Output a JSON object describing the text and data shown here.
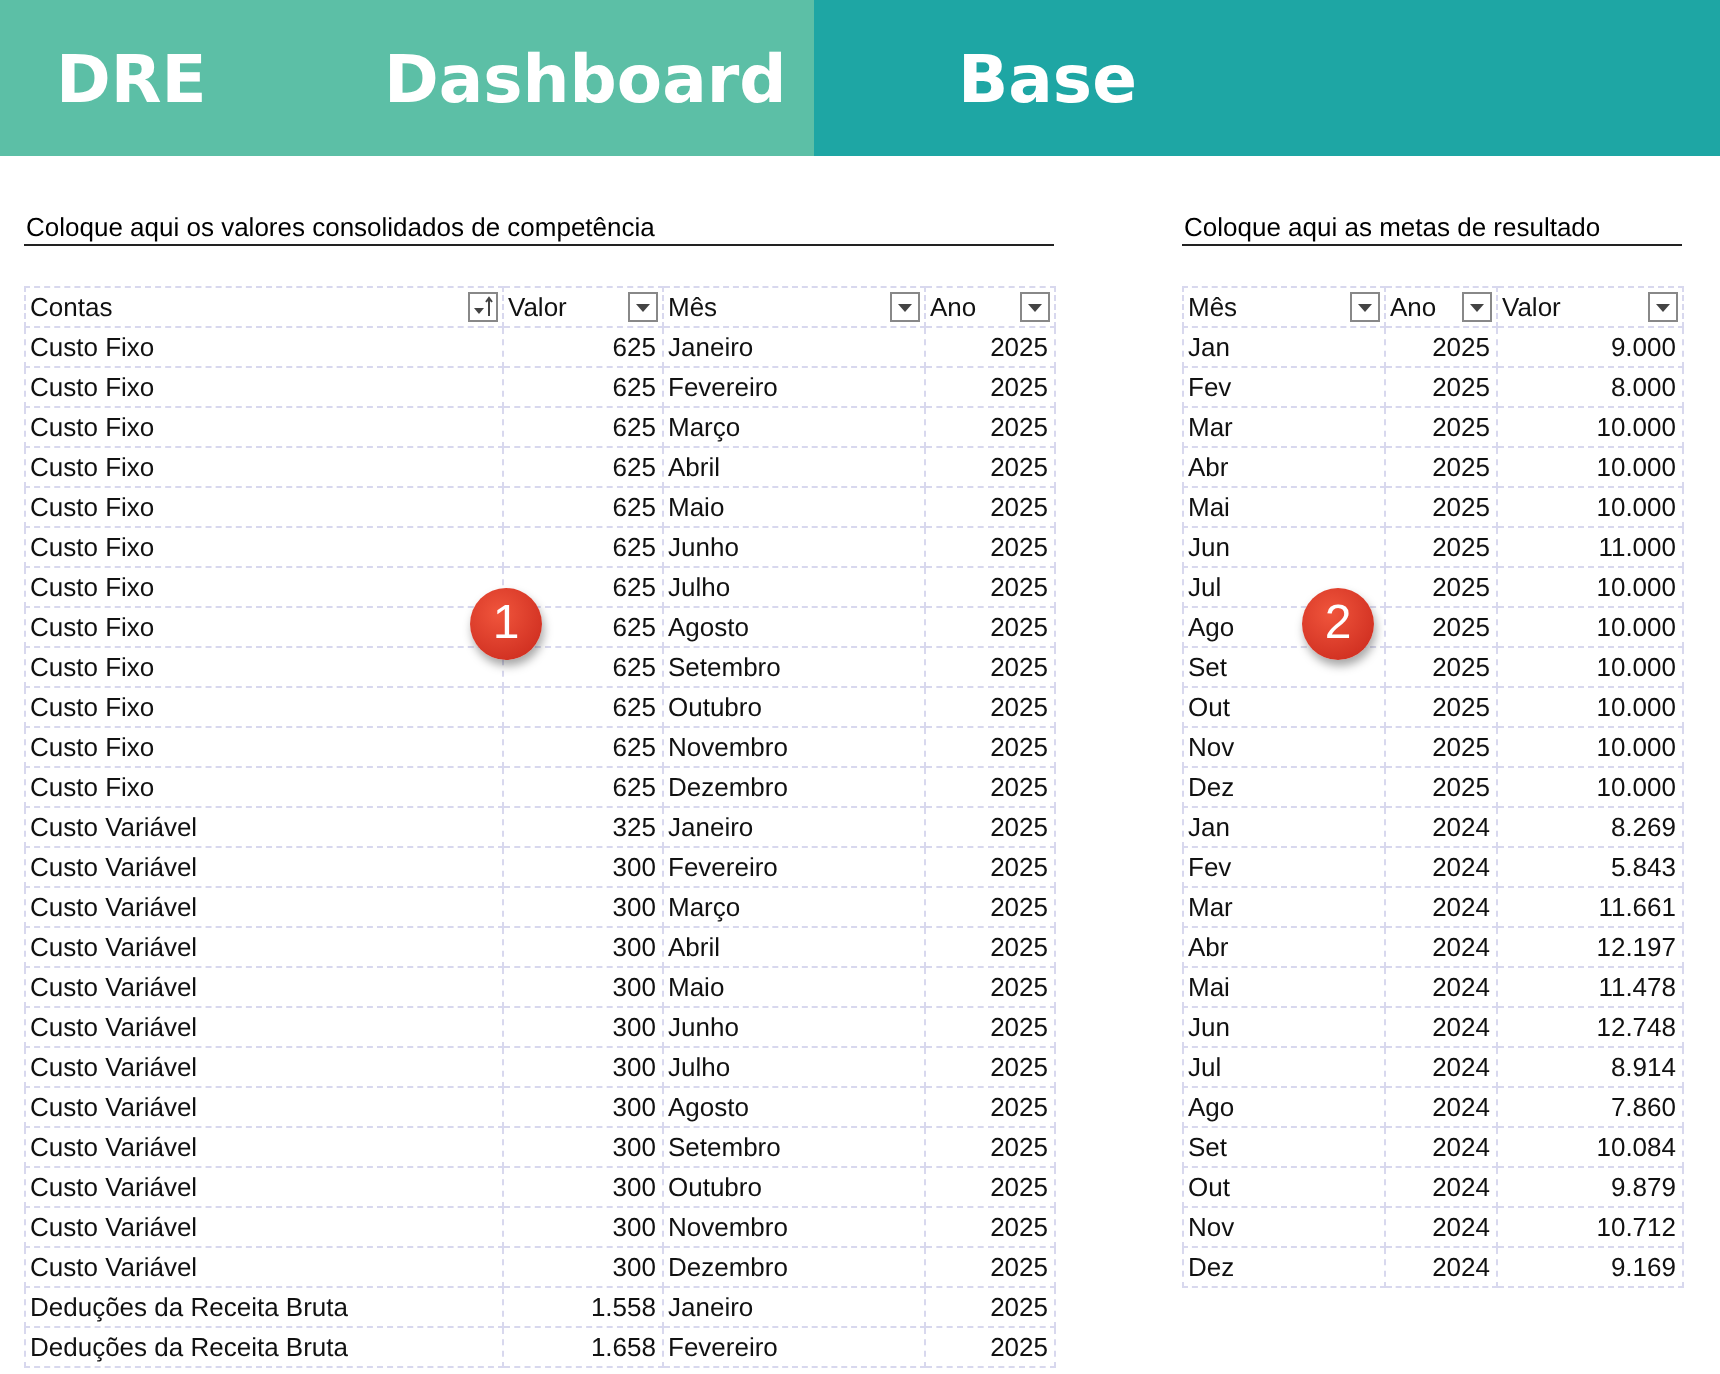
{
  "tabs": [
    {
      "label": "DRE",
      "selected": false
    },
    {
      "label": "Dashboard",
      "selected": false
    },
    {
      "label": "Base",
      "selected": true
    }
  ],
  "sections": [
    {
      "title": "Coloque aqui os valores consolidados de competência",
      "badge": "1",
      "columns": [
        {
          "label": "Contas",
          "kind": "text",
          "sorted": true
        },
        {
          "label": "Valor",
          "kind": "number",
          "sorted": false
        },
        {
          "label": "Mês",
          "kind": "text",
          "sorted": false
        },
        {
          "label": "Ano",
          "kind": "number",
          "sorted": false
        }
      ],
      "rows": [
        [
          "Custo Fixo",
          "625",
          "Janeiro",
          "2025"
        ],
        [
          "Custo Fixo",
          "625",
          "Fevereiro",
          "2025"
        ],
        [
          "Custo Fixo",
          "625",
          "Março",
          "2025"
        ],
        [
          "Custo Fixo",
          "625",
          "Abril",
          "2025"
        ],
        [
          "Custo Fixo",
          "625",
          "Maio",
          "2025"
        ],
        [
          "Custo Fixo",
          "625",
          "Junho",
          "2025"
        ],
        [
          "Custo Fixo",
          "625",
          "Julho",
          "2025"
        ],
        [
          "Custo Fixo",
          "625",
          "Agosto",
          "2025"
        ],
        [
          "Custo Fixo",
          "625",
          "Setembro",
          "2025"
        ],
        [
          "Custo Fixo",
          "625",
          "Outubro",
          "2025"
        ],
        [
          "Custo Fixo",
          "625",
          "Novembro",
          "2025"
        ],
        [
          "Custo Fixo",
          "625",
          "Dezembro",
          "2025"
        ],
        [
          "Custo Variável",
          "325",
          "Janeiro",
          "2025"
        ],
        [
          "Custo Variável",
          "300",
          "Fevereiro",
          "2025"
        ],
        [
          "Custo Variável",
          "300",
          "Março",
          "2025"
        ],
        [
          "Custo Variável",
          "300",
          "Abril",
          "2025"
        ],
        [
          "Custo Variável",
          "300",
          "Maio",
          "2025"
        ],
        [
          "Custo Variável",
          "300",
          "Junho",
          "2025"
        ],
        [
          "Custo Variável",
          "300",
          "Julho",
          "2025"
        ],
        [
          "Custo Variável",
          "300",
          "Agosto",
          "2025"
        ],
        [
          "Custo Variável",
          "300",
          "Setembro",
          "2025"
        ],
        [
          "Custo Variável",
          "300",
          "Outubro",
          "2025"
        ],
        [
          "Custo Variável",
          "300",
          "Novembro",
          "2025"
        ],
        [
          "Custo Variável",
          "300",
          "Dezembro",
          "2025"
        ],
        [
          "Deduções da Receita Bruta",
          "1.558",
          "Janeiro",
          "2025"
        ],
        [
          "Deduções da Receita Bruta",
          "1.658",
          "Fevereiro",
          "2025"
        ]
      ]
    },
    {
      "title": "Coloque aqui as metas de resultado",
      "badge": "2",
      "columns": [
        {
          "label": "Mês",
          "kind": "text",
          "sorted": false
        },
        {
          "label": "Ano",
          "kind": "number",
          "sorted": false
        },
        {
          "label": "Valor",
          "kind": "number",
          "sorted": false
        }
      ],
      "rows": [
        [
          "Jan",
          "2025",
          "9.000"
        ],
        [
          "Fev",
          "2025",
          "8.000"
        ],
        [
          "Mar",
          "2025",
          "10.000"
        ],
        [
          "Abr",
          "2025",
          "10.000"
        ],
        [
          "Mai",
          "2025",
          "10.000"
        ],
        [
          "Jun",
          "2025",
          "11.000"
        ],
        [
          "Jul",
          "2025",
          "10.000"
        ],
        [
          "Ago",
          "2025",
          "10.000"
        ],
        [
          "Set",
          "2025",
          "10.000"
        ],
        [
          "Out",
          "2025",
          "10.000"
        ],
        [
          "Nov",
          "2025",
          "10.000"
        ],
        [
          "Dez",
          "2025",
          "10.000"
        ],
        [
          "Jan",
          "2024",
          "8.269"
        ],
        [
          "Fev",
          "2024",
          "5.843"
        ],
        [
          "Mar",
          "2024",
          "11.661"
        ],
        [
          "Abr",
          "2024",
          "12.197"
        ],
        [
          "Mai",
          "2024",
          "11.478"
        ],
        [
          "Jun",
          "2024",
          "12.748"
        ],
        [
          "Jul",
          "2024",
          "8.914"
        ],
        [
          "Ago",
          "2024",
          "7.860"
        ],
        [
          "Set",
          "2024",
          "10.084"
        ],
        [
          "Out",
          "2024",
          "9.879"
        ],
        [
          "Nov",
          "2024",
          "10.712"
        ],
        [
          "Dez",
          "2024",
          "9.169"
        ]
      ]
    }
  ]
}
